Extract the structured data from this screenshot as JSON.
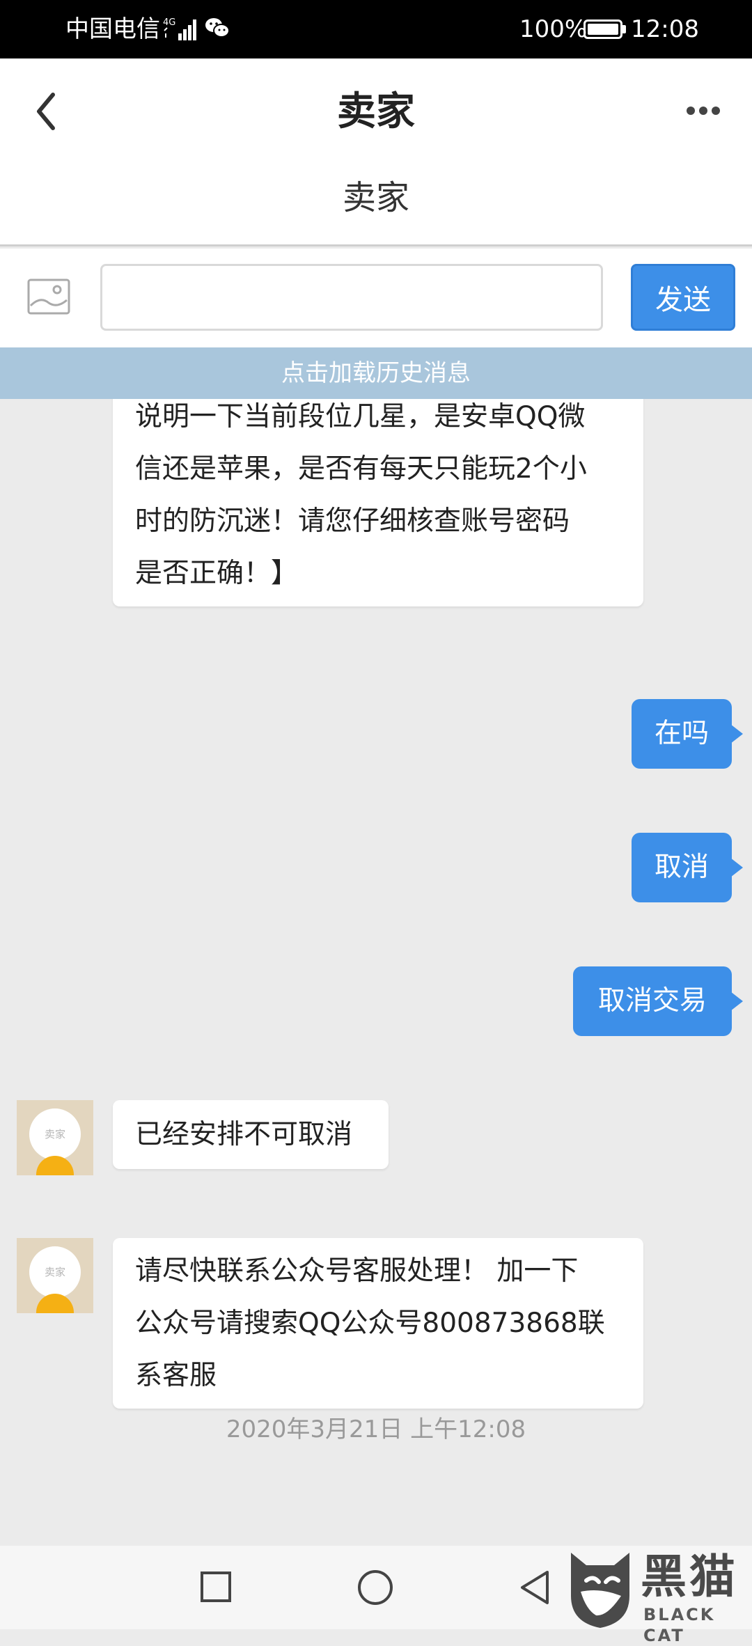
{
  "status_bar": {
    "carrier": "中国电信",
    "network": "4G",
    "battery": "100%",
    "time": "12:08"
  },
  "header": {
    "title": "卖家",
    "subtitle": "卖家"
  },
  "composer": {
    "input_value": "",
    "send_label": "发送"
  },
  "load_history_label": "点击加载历史消息",
  "messages": [
    {
      "side": "left",
      "lines": [
        "说明一下当前段位几星，是安卓QQ微",
        "信还是苹果，是否有每天只能玩2个小",
        "时的防沉迷！请您仔细核查账号密码",
        "是否正确！】"
      ]
    },
    {
      "side": "right",
      "text": "在吗"
    },
    {
      "side": "right",
      "text": "取消"
    },
    {
      "side": "right",
      "text": "取消交易"
    },
    {
      "side": "left",
      "avatar_label": "卖家",
      "text": "已经安排不可取消"
    },
    {
      "side": "left",
      "avatar_label": "卖家",
      "lines": [
        "请尽快联系公众号客服处理！ 加一下",
        "公众号请搜索QQ公众号800873868联",
        "系客服"
      ]
    }
  ],
  "timestamp": "2020年3月21日 上午12:08",
  "watermark": {
    "cn": "黑猫",
    "en": "BLACK CAT"
  },
  "colors": {
    "accent": "#3d8fe8",
    "chat_background": "#ebebeb",
    "load_history_bar": "#a9c6dc",
    "avatar_bg": "#e3d6bf",
    "avatar_body": "#f5b014"
  },
  "icons": [
    "signal-icon",
    "wechat-icon",
    "battery-icon",
    "back-arrow-icon",
    "more-icon",
    "image-icon",
    "nav-recent-icon",
    "nav-home-icon",
    "nav-back-icon",
    "black-cat-logo-icon"
  ]
}
